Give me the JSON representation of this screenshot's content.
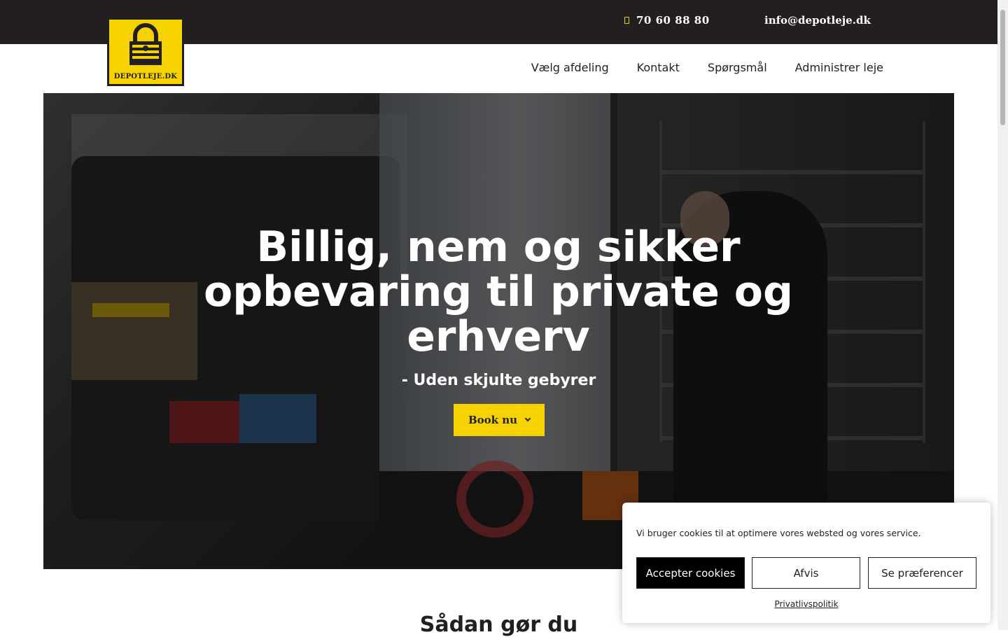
{
  "topbar": {
    "phone": "70 60 88 80",
    "email": "info@depotleje.dk"
  },
  "logo": {
    "text": "DEPOTLEJE.DK"
  },
  "nav": {
    "items": [
      "Vælg afdeling",
      "Kontakt",
      "Spørgsmål",
      "Administrer leje"
    ]
  },
  "hero": {
    "title": "Billig, nem og sikker opbevaring til private og erhverv",
    "subtitle": "- Uden skjulte gebyrer",
    "cta_label": "Book nu"
  },
  "section": {
    "title": "Sådan gør du"
  },
  "cookie": {
    "message": "Vi bruger cookies til at optimere vores websted og vores service.",
    "accept_label": "Accepter cookies",
    "deny_label": "Afvis",
    "prefs_label": "Se præferencer",
    "policy_label": "Privatlivspolitik"
  },
  "colors": {
    "brand_yellow": "#f5d200",
    "dark": "#231f20"
  }
}
